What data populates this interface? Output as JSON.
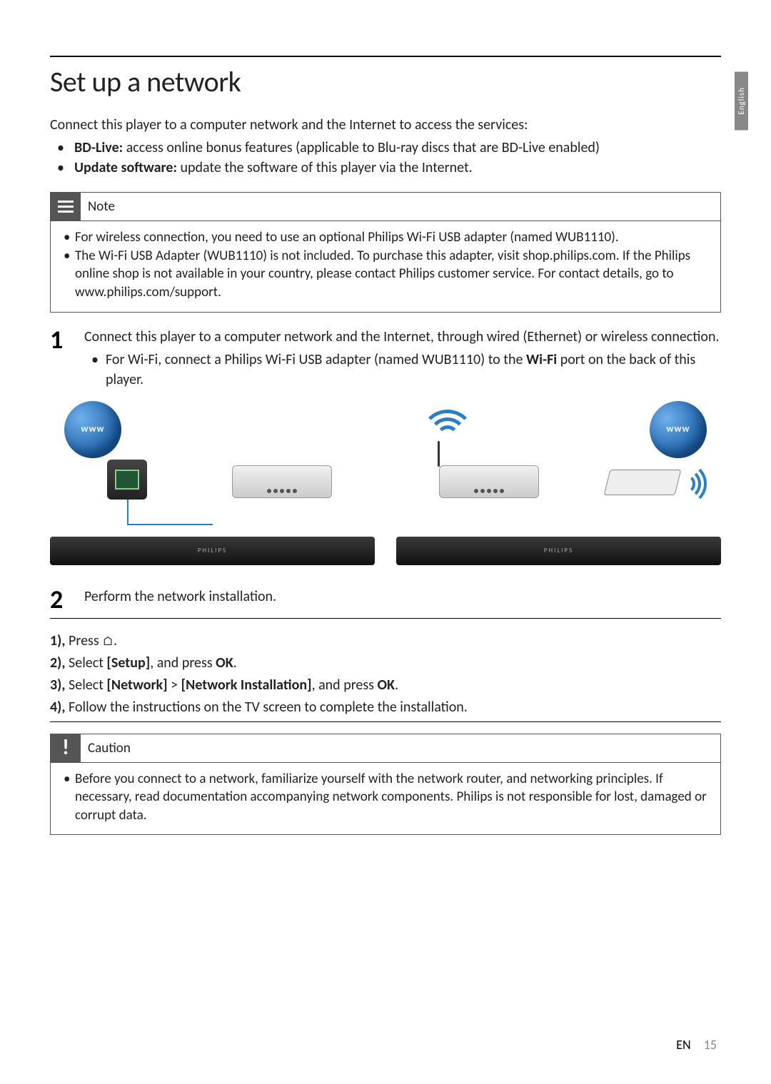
{
  "sideTab": "English",
  "title": "Set up a network",
  "intro": "Connect this player to a computer network and the Internet to access the services:",
  "features": [
    {
      "bold": "BD-Live:",
      "text": " access online bonus features (applicable to Blu-ray discs that are BD-Live enabled)"
    },
    {
      "bold": "Update software:",
      "text": " update the software of this player via the Internet."
    }
  ],
  "noteTitle": "Note",
  "noteItems": [
    "For wireless connection, you need to use an optional Philips Wi-Fi USB adapter (named WUB1110).",
    "The Wi-Fi USB Adapter (WUB1110) is not included. To purchase this adapter, visit shop.philips.com. If the Philips online shop is not available in your country, please contact Philips customer service. For contact details, go to www.philips.com/support."
  ],
  "step1": {
    "num": "1",
    "text": "Connect this player to a computer network and the Internet, through wired (Ethernet) or wireless connection.",
    "subPrefix": "For Wi-Fi, connect a Philips Wi-Fi USB adapter (named WUB1110) to the ",
    "subBold": "Wi-Fi",
    "subSuffix": " port on the back of this player."
  },
  "playerBrand": "PHILIPS",
  "step2": {
    "num": "2",
    "text": "Perform the network installation."
  },
  "mini": {
    "l1a": "1),",
    "l1b": " Press ",
    "l2a": "2),",
    "l2b": " Select ",
    "l2c": "[Setup]",
    "l2d": ", and press ",
    "l2e": "OK",
    "l2f": ".",
    "l3a": "3),",
    "l3b": " Select ",
    "l3c": "[Network]",
    "l3d": " > ",
    "l3e": "[Network Installation]",
    "l3f": ", and press ",
    "l3g": "OK",
    "l3h": ".",
    "l4a": "4),",
    "l4b": " Follow the instructions on the TV screen to complete the installation."
  },
  "cautionTitle": "Caution",
  "cautionItems": [
    "Before you connect to a network, familiarize yourself with the network router, and networking principles. If necessary, read documentation accompanying network components. Philips is not responsible for lost, damaged or corrupt data."
  ],
  "footer": {
    "lang": "EN",
    "page": "15"
  }
}
